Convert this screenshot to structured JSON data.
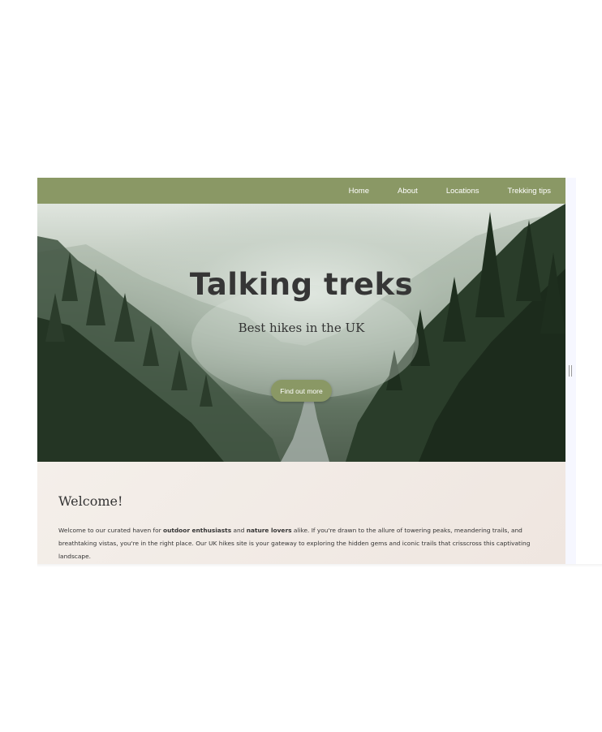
{
  "nav": {
    "items": [
      {
        "label": "Home"
      },
      {
        "label": "About"
      },
      {
        "label": "Locations"
      },
      {
        "label": "Trekking tips"
      }
    ]
  },
  "hero": {
    "title": "Talking treks",
    "subtitle": "Best hikes in the UK",
    "cta_label": "Find out more"
  },
  "welcome": {
    "heading": "Welcome!",
    "text_part1": "Welcome to our curated haven for ",
    "bold1": "outdoor enthusiasts",
    "text_part2": " and ",
    "bold2": "nature lovers",
    "text_part3": " alike. If you're drawn to the allure of towering peaks, meandering trails, and breathtaking vistas, you're in the right place. Our UK hikes site is your gateway to exploring the hidden gems and iconic trails that crisscross this captivating landscape."
  },
  "colors": {
    "accent": "#8a9865",
    "text": "#333333",
    "welcome_bg": "#f2ebe6"
  }
}
